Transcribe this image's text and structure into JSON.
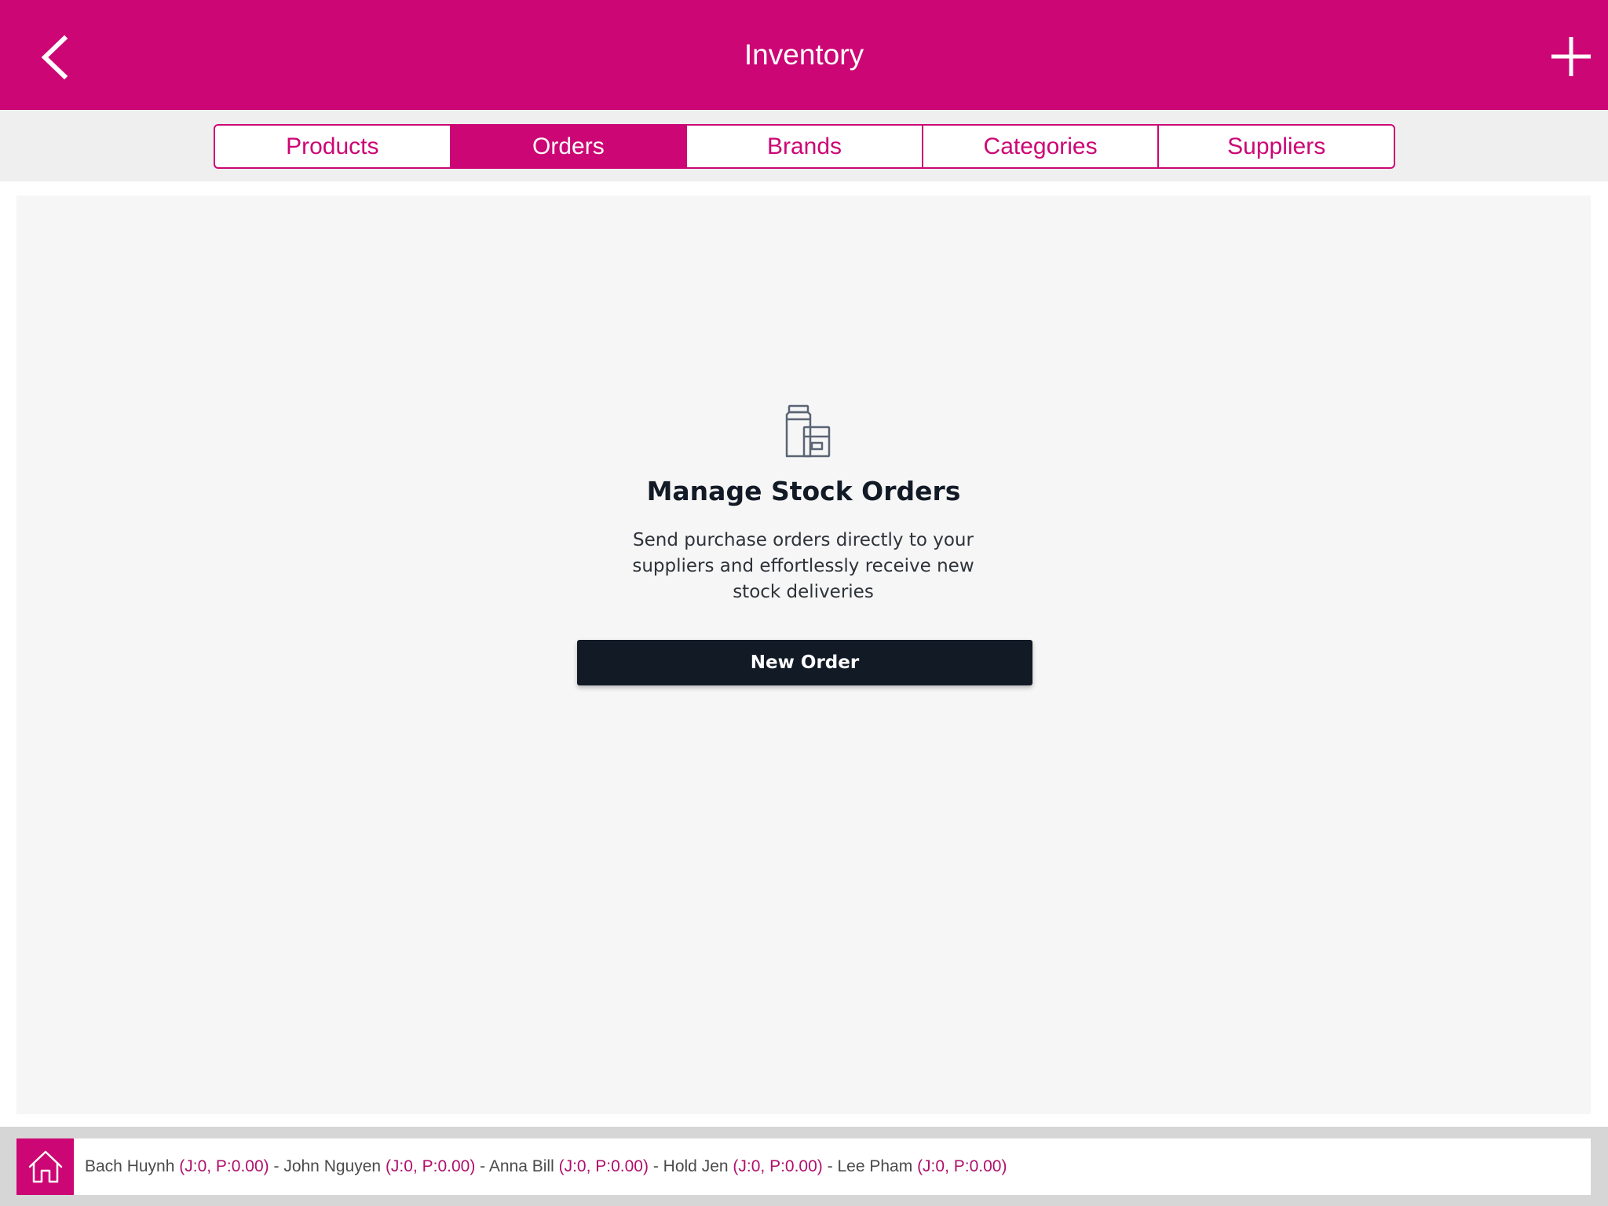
{
  "header": {
    "title": "Inventory",
    "icons": {
      "back": "chevron-left-icon",
      "add": "plus-icon"
    },
    "background": "#cc0674"
  },
  "tabs": [
    {
      "label": "Products",
      "active": false
    },
    {
      "label": "Orders",
      "active": true
    },
    {
      "label": "Brands",
      "active": false
    },
    {
      "label": "Categories",
      "active": false
    },
    {
      "label": "Suppliers",
      "active": false
    }
  ],
  "empty_state": {
    "icon": "stock-boxes-icon",
    "heading": "Manage Stock Orders",
    "description": "Send purchase orders directly to your suppliers and effortlessly receive new stock deliveries",
    "button_label": "New Order"
  },
  "footer": {
    "home_icon": "home-icon",
    "staff": [
      {
        "name": "Bach Huynh",
        "stats": "(J:0, P:0.00)"
      },
      {
        "name": "John Nguyen",
        "stats": "(J:0, P:0.00)"
      },
      {
        "name": "Anna Bill",
        "stats": "(J:0, P:0.00)"
      },
      {
        "name": "Hold Jen",
        "stats": "(J:0, P:0.00)"
      },
      {
        "name": "Lee Pham",
        "stats": "(J:0, P:0.00)"
      }
    ],
    "separator": "-"
  },
  "colors": {
    "accent": "#cc0674",
    "dark_button": "#121a26",
    "content_bg": "#f6f6f6"
  }
}
